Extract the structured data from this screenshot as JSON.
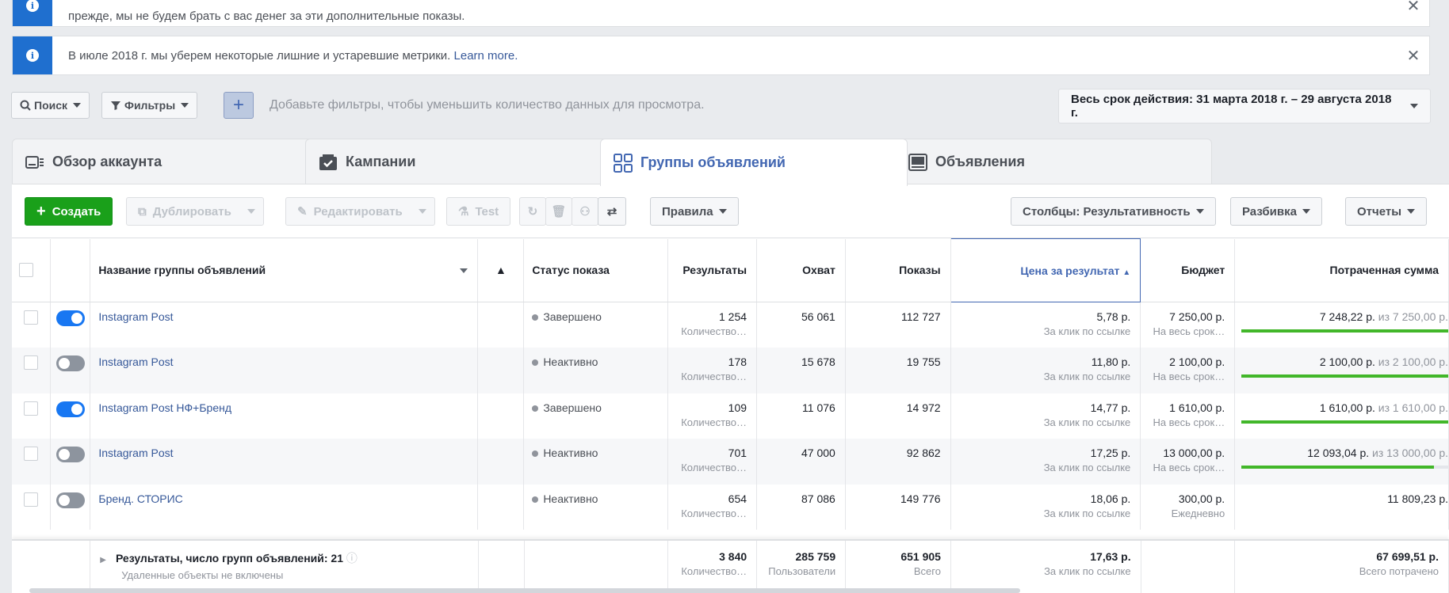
{
  "notices": [
    {
      "text": "прежде, мы не будем брать с вас денег за эти дополнительные показы.",
      "link": ""
    },
    {
      "text": "В июле 2018 г. мы уберем некоторые лишние и устаревшие метрики.",
      "link": "Learn more."
    }
  ],
  "filters": {
    "search_label": "Поиск",
    "filters_label": "Фильтры",
    "add_icon": "plus-icon",
    "hint": "Добавьте фильтры, чтобы уменьшить количество данных для просмотра.",
    "date_range": "Весь срок действия: 31 марта 2018 г. – 29 августа 2018 г."
  },
  "tabs": [
    {
      "label": "Обзор аккаунта",
      "icon": "account-overview-icon"
    },
    {
      "label": "Кампании",
      "icon": "campaign-check-icon"
    },
    {
      "label": "Группы объявлений",
      "icon": "adsets-grid-icon",
      "active": true
    },
    {
      "label": "Объявления",
      "icon": "ad-display-icon"
    }
  ],
  "toolbar": {
    "create": "Создать",
    "duplicate": "Дублировать",
    "edit": "Редактировать",
    "test": "Test",
    "rules": "Правила",
    "columns": "Столбцы: Результативность",
    "breakdown": "Разбивка",
    "reports": "Отчеты"
  },
  "table": {
    "headers": {
      "name": "Название группы объявлений",
      "status": "Статус показа",
      "results": "Результаты",
      "reach": "Охват",
      "impressions": "Показы",
      "cost": "Цена за результат",
      "budget": "Бюджет",
      "spent": "Потраченная сумма"
    },
    "rows": [
      {
        "on": true,
        "name": "Instagram Post",
        "status": "Завершено",
        "results": "1 254",
        "results_sub": "Количество…",
        "reach": "56 061",
        "impressions": "112 727",
        "cost": "5,78 р.",
        "cost_sub": "За клик по ссылке",
        "budget": "7 250,00 р.",
        "budget_sub": "На весь срок…",
        "spent": "7 248,22 р.",
        "spent_of": "из 7 250,00 р.",
        "spent_pct": 99.9
      },
      {
        "on": false,
        "name": "Instagram Post",
        "status": "Неактивно",
        "results": "178",
        "results_sub": "Количество…",
        "reach": "15 678",
        "impressions": "19 755",
        "cost": "11,80 р.",
        "cost_sub": "За клик по ссылке",
        "budget": "2 100,00 р.",
        "budget_sub": "На весь срок…",
        "spent": "2 100,00 р.",
        "spent_of": "из 2 100,00 р.",
        "spent_pct": 100
      },
      {
        "on": true,
        "name": "Instagram Post НФ+Бренд",
        "status": "Завершено",
        "results": "109",
        "results_sub": "Количество…",
        "reach": "11 076",
        "impressions": "14 972",
        "cost": "14,77 р.",
        "cost_sub": "За клик по ссылке",
        "budget": "1 610,00 р.",
        "budget_sub": "На весь срок…",
        "spent": "1 610,00 р.",
        "spent_of": "из 1 610,00 р.",
        "spent_pct": 100
      },
      {
        "on": false,
        "name": "Instagram Post",
        "status": "Неактивно",
        "results": "701",
        "results_sub": "Количество…",
        "reach": "47 000",
        "impressions": "92 862",
        "cost": "17,25 р.",
        "cost_sub": "За клик по ссылке",
        "budget": "13 000,00 р.",
        "budget_sub": "На весь срок…",
        "spent": "12 093,04 р.",
        "spent_of": "из 13 000,00 р.",
        "spent_pct": 93
      },
      {
        "on": false,
        "name": "Бренд. СТОРИС",
        "status": "Неактивно",
        "results": "654",
        "results_sub": "Количество…",
        "reach": "87 086",
        "impressions": "149 776",
        "cost": "18,06 р.",
        "cost_sub": "За клик по ссылке",
        "budget": "300,00 р.",
        "budget_sub": "Ежедневно",
        "spent": "11 809,23 р.",
        "spent_of": "",
        "spent_pct": null
      }
    ],
    "totals": {
      "label": "Результаты, число групп объявлений: 21",
      "sub": "Удаленные объекты не включены",
      "results": "3 840",
      "results_sub": "Количество…",
      "reach": "285 759",
      "reach_sub": "Пользователи",
      "impressions": "651 905",
      "impressions_sub": "Всего",
      "cost": "17,63 р.",
      "cost_sub": "За клик по ссылке",
      "spent": "67 699,51 р.",
      "spent_sub": "Всего потрачено"
    }
  }
}
